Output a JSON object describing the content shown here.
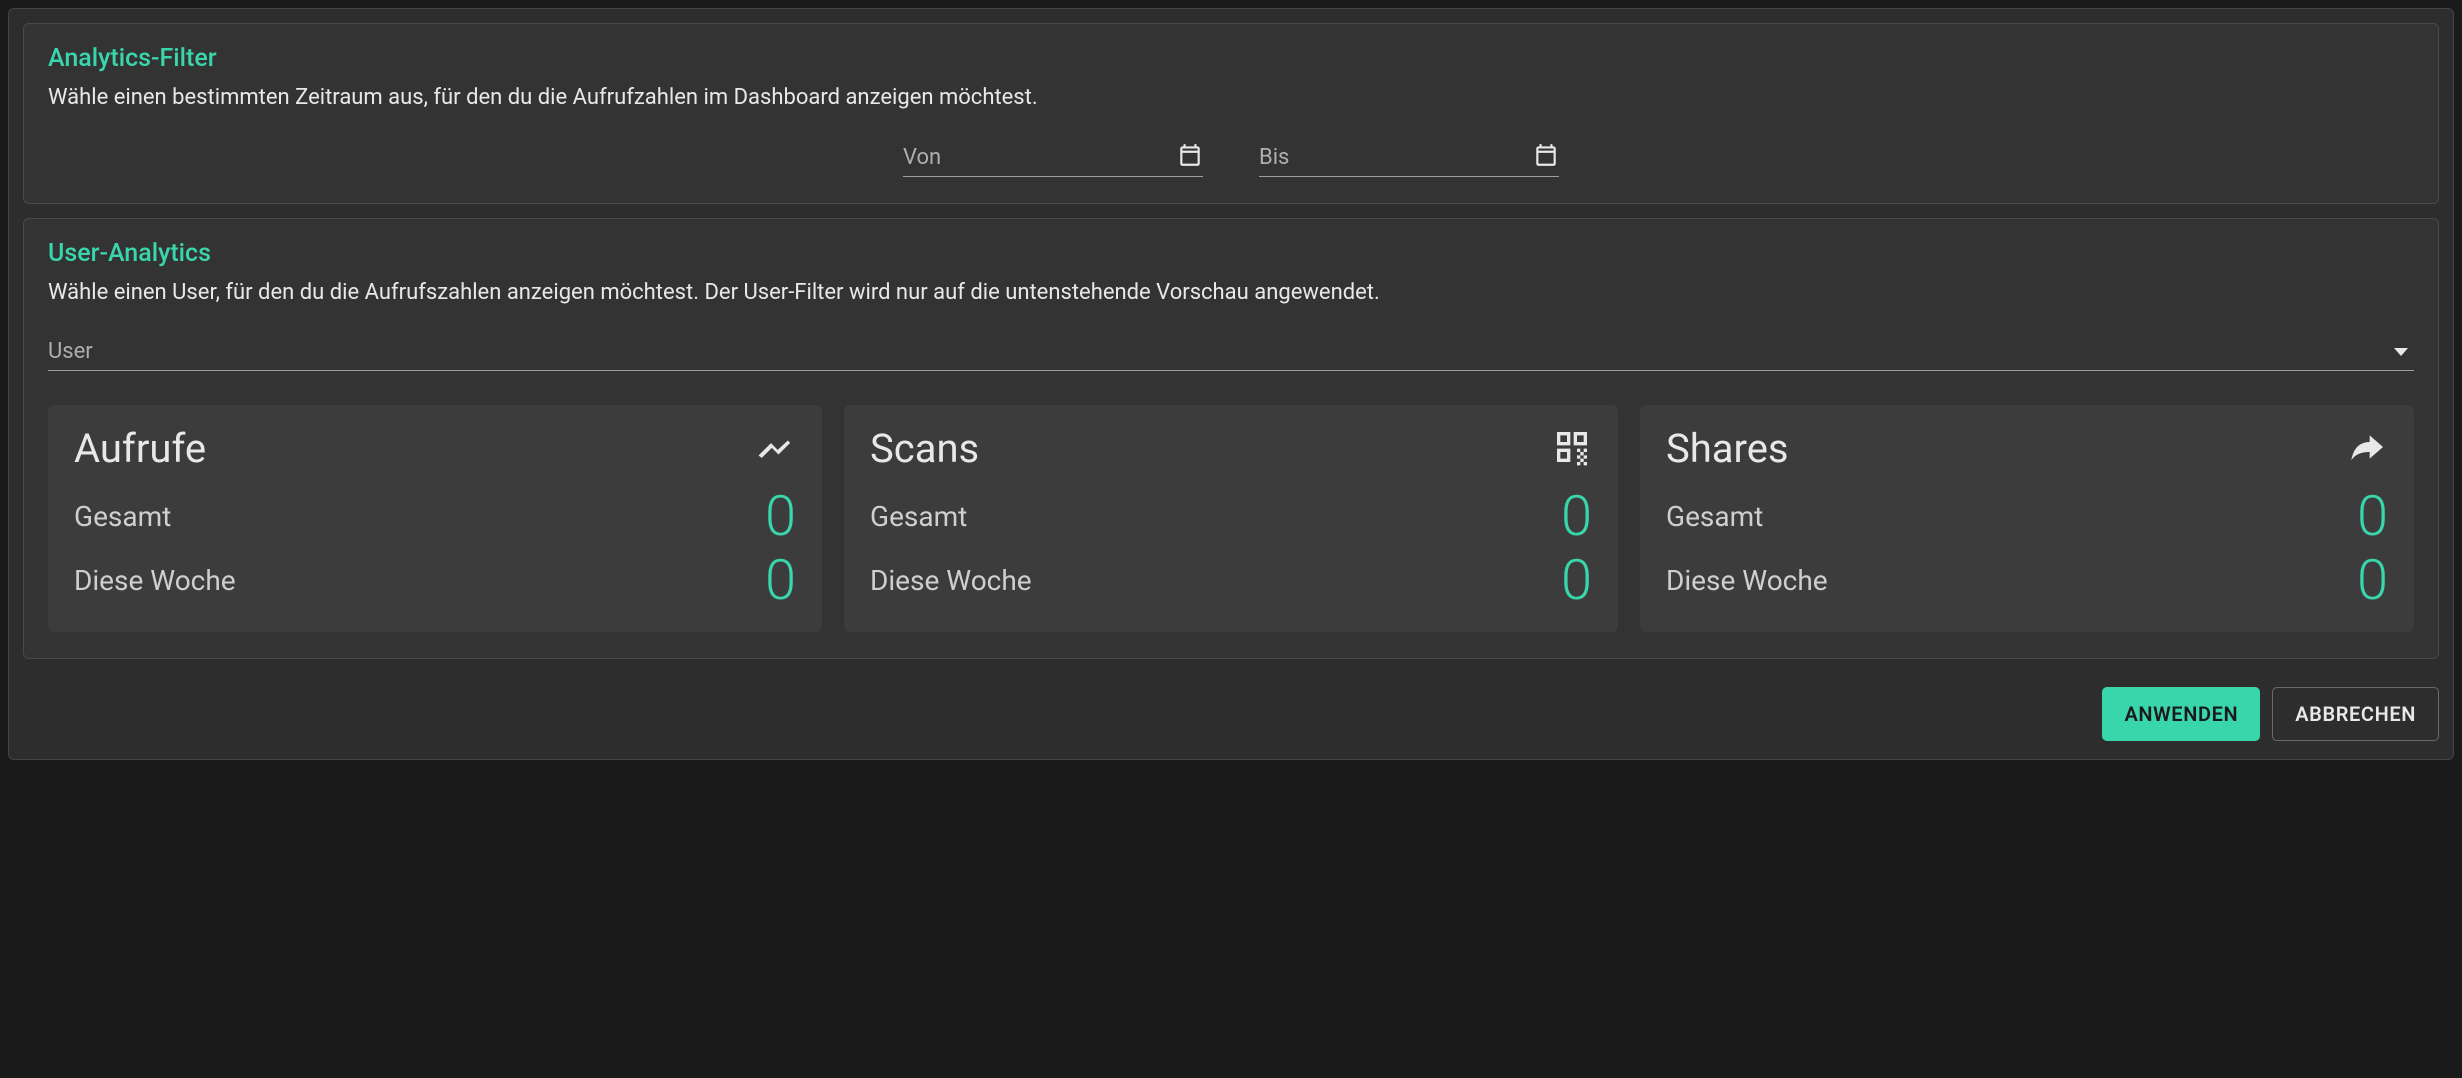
{
  "analyticsFilter": {
    "title": "Analytics-Filter",
    "description": "Wähle einen bestimmten Zeitraum aus, für den du die Aufrufzahlen im Dashboard anzeigen möchtest.",
    "from": {
      "label": "Von",
      "value": ""
    },
    "to": {
      "label": "Bis",
      "value": ""
    }
  },
  "userAnalytics": {
    "title": "User-Analytics",
    "description": "Wähle einen User, für den du die Aufrufszahlen anzeigen möchtest. Der User-Filter wird nur auf die untenstehende Vorschau angewendet.",
    "userSelect": {
      "label": "User",
      "value": ""
    },
    "cards": [
      {
        "title": "Aufrufe",
        "icon": "trend-icon",
        "totalLabel": "Gesamt",
        "totalValue": "0",
        "weekLabel": "Diese Woche",
        "weekValue": "0"
      },
      {
        "title": "Scans",
        "icon": "qr-icon",
        "totalLabel": "Gesamt",
        "totalValue": "0",
        "weekLabel": "Diese Woche",
        "weekValue": "0"
      },
      {
        "title": "Shares",
        "icon": "share-icon",
        "totalLabel": "Gesamt",
        "totalValue": "0",
        "weekLabel": "Diese Woche",
        "weekValue": "0"
      }
    ]
  },
  "actions": {
    "apply": "ANWENDEN",
    "cancel": "ABBRECHEN"
  },
  "colors": {
    "accent": "#39d6ac",
    "bg": "#2d2d2d",
    "panel": "#333333",
    "card": "#3c3c3c"
  }
}
